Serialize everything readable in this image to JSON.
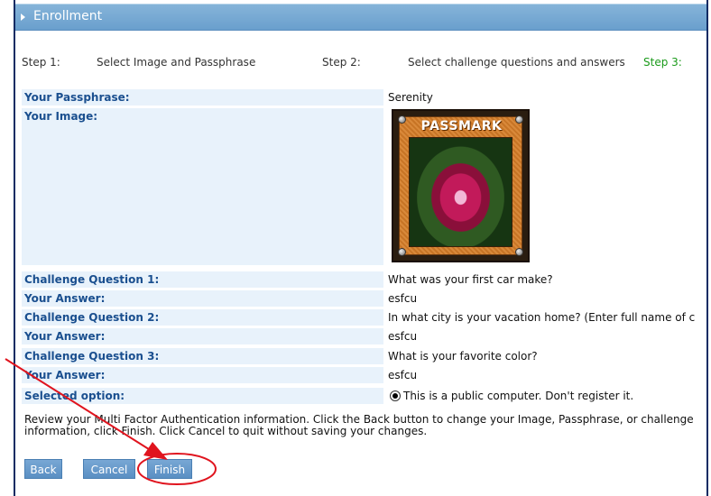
{
  "header": {
    "title": "Enrollment"
  },
  "steps": [
    {
      "label": "Step 1:",
      "text": "Select Image and Passphrase"
    },
    {
      "label": "Step 2:",
      "text": "Select challenge questions and answers"
    },
    {
      "label": "Step 3:"
    }
  ],
  "fields": {
    "passphrase_label": "Your Passphrase:",
    "passphrase_value": "Serenity",
    "image_label": "Your Image:",
    "image_brand": "PASSMARK",
    "cq1_label": "Challenge Question 1:",
    "cq1_value": "What was your first car make?",
    "ans1_label": "Your Answer:",
    "ans1_value": "esfcu",
    "cq2_label": "Challenge Question 2:",
    "cq2_value": "In what city is your vacation home? (Enter full name of c",
    "ans2_label": "Your Answer:",
    "ans2_value": "esfcu",
    "cq3_label": "Challenge Question 3:",
    "cq3_value": "What is your favorite color?",
    "ans3_label": "Your Answer:",
    "ans3_value": "esfcu",
    "option_label": "Selected option:",
    "option_value": "This is a public computer. Don't register it."
  },
  "review": {
    "line1": "Review your Multi Factor Authentication information. Click the Back button to change your Image, Passphrase, or challenge",
    "line2": "information, click Finish. Click Cancel to quit without saving your changes."
  },
  "buttons": {
    "back": "Back",
    "cancel": "Cancel",
    "finish": "Finish"
  },
  "colors": {
    "title_bar": "#6a9fcd",
    "label_text": "#1a4f8f",
    "label_bg": "#e8f2fb",
    "active_step": "#1a9a1a",
    "annotation": "#e0141e"
  }
}
